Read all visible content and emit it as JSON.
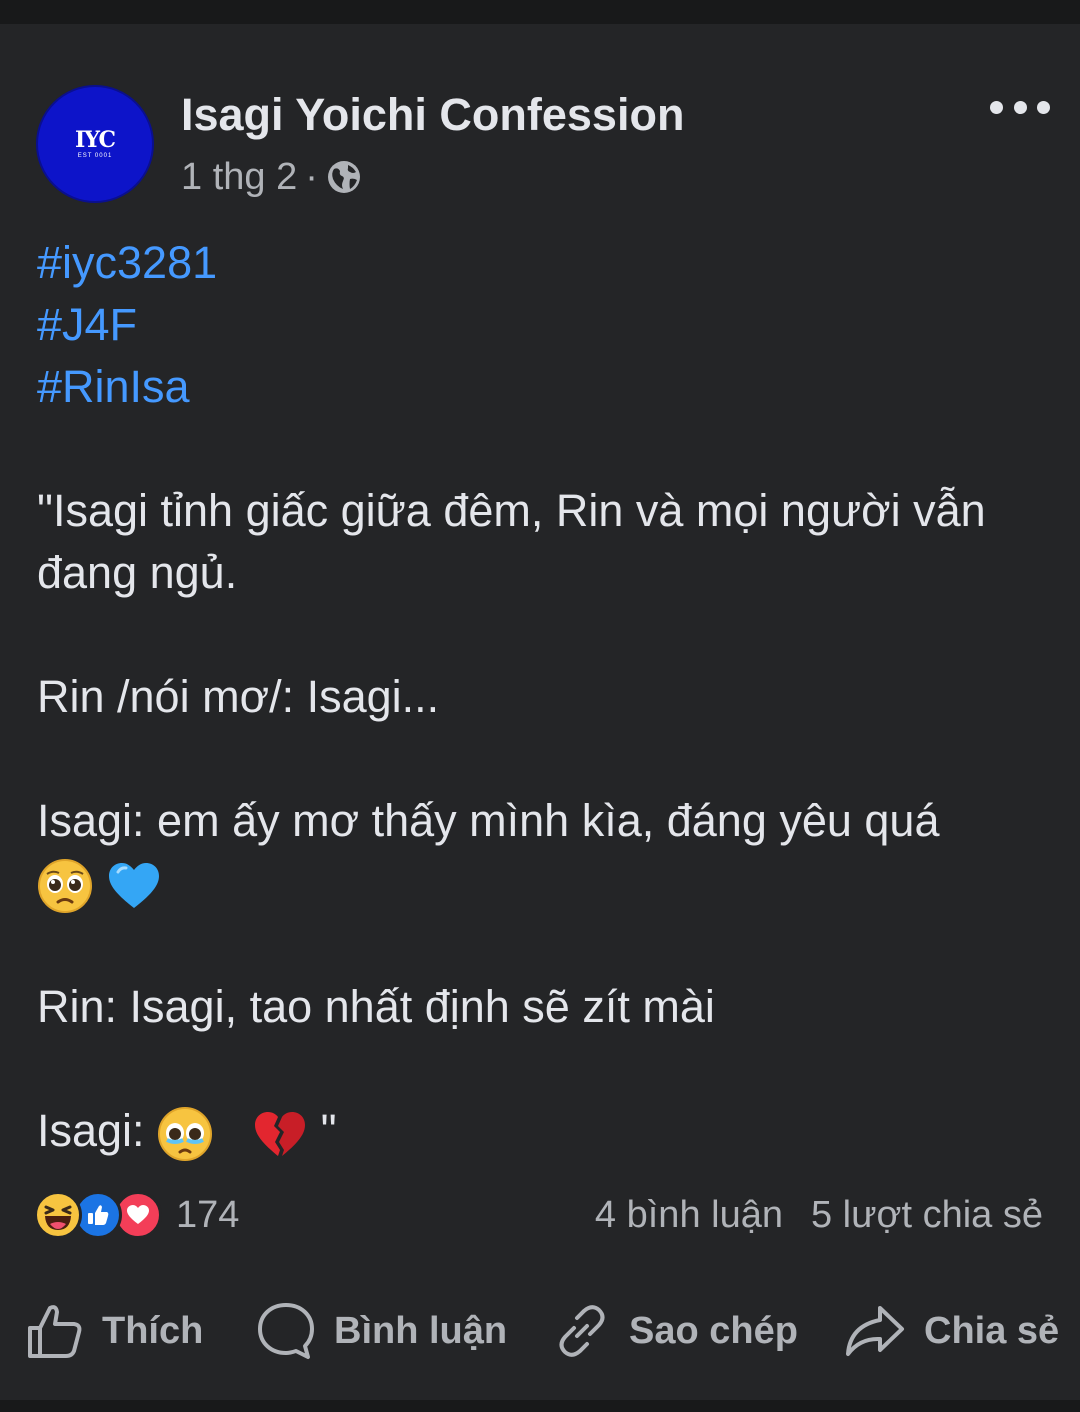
{
  "post": {
    "page_name": "Isagi Yoichi Confession",
    "avatar_text": "IYC",
    "avatar_subtext": "EST 0001",
    "timestamp": "1 thg 2",
    "separator": "·",
    "privacy_icon": "globe-icon",
    "more_icon": "more-horizontal-icon"
  },
  "content": {
    "hashtags": [
      "#iyc3281",
      "#J4F",
      "#RinIsa"
    ],
    "line1": "\"Isagi tỉnh giấc giữa đêm, Rin và mọi người vẫn đang ngủ.",
    "line2": "Rin /nói mơ/: Isagi...",
    "line3": "Isagi: em ấy mơ thấy mình kìa, đáng yêu quá",
    "line3_emojis": [
      "pleading-face-emoji",
      "blue-heart-emoji"
    ],
    "line4": "Rin: Isagi, tao nhất định sẽ zít mài",
    "line5_prefix": "Isagi: ",
    "line5_emojis": [
      "tearful-face-emoji",
      "broken-heart-emoji"
    ],
    "line5_suffix": "\""
  },
  "reactions": {
    "icons": [
      "haha-reaction-icon",
      "like-reaction-icon",
      "love-reaction-icon"
    ],
    "count": "174",
    "comments": "4 bình luận",
    "shares": "5 lượt chia sẻ"
  },
  "actions": {
    "like": "Thích",
    "comment": "Bình luận",
    "copy": "Sao chép",
    "share": "Chia sẻ"
  },
  "colors": {
    "background": "#242527",
    "text": "#e4e6eb",
    "secondary": "#b0b3b8",
    "hashtag": "#4599ff",
    "avatar": "#0d14c9"
  }
}
